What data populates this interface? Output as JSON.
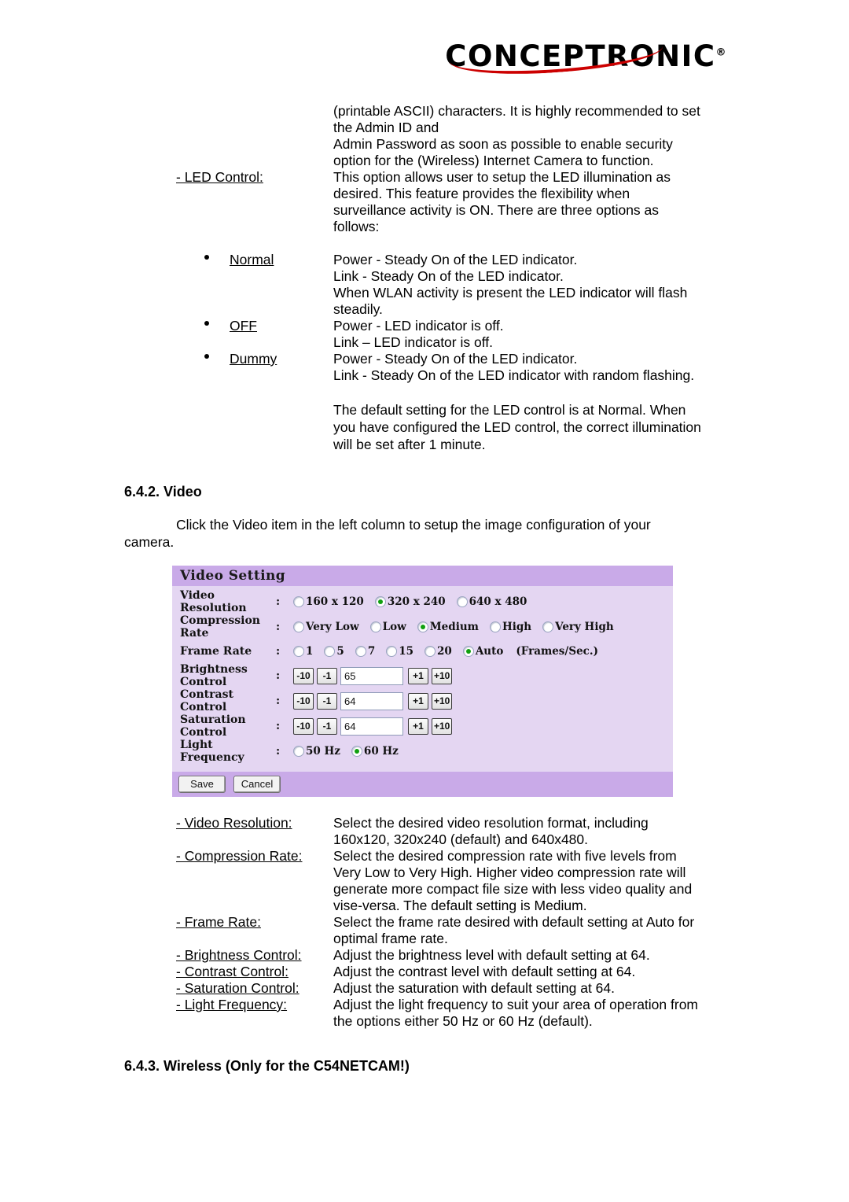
{
  "brand": {
    "name": "CONCEPTRONIC",
    "registered": "®"
  },
  "intro": {
    "lines": [
      "(printable ASCII) characters. It is highly recommended to set",
      "the Admin ID and",
      "Admin Password as soon as possible to enable security",
      "option for the (Wireless) Internet Camera to function."
    ]
  },
  "led_control": {
    "label": "- LED Control:",
    "lines": [
      "This option allows user to setup the LED illumination as",
      "desired.  This feature provides the flexibility when",
      "surveillance activity is ON. There are three options as",
      "follows:"
    ]
  },
  "led_options": [
    {
      "name": "Normal",
      "lines": [
        "Power - Steady On of the LED indicator.",
        "Link - Steady On of the LED indicator.",
        "When WLAN activity is present the LED indicator will flash",
        "steadily."
      ]
    },
    {
      "name": "OFF",
      "lines": [
        "Power - LED indicator is off.",
        "Link – LED indicator is off."
      ]
    },
    {
      "name": "Dummy",
      "lines": [
        "Power - Steady On of the LED indicator.",
        "Link - Steady On of the LED indicator with random flashing."
      ]
    }
  ],
  "led_default_note": {
    "lines": [
      "The default setting for the LED control is at  Normal.  When",
      "you have configured the LED control, the correct illumination",
      "will be set after 1 minute."
    ]
  },
  "section_video": {
    "heading": "6.4.2. Video",
    "intro_lines": [
      "Click the  Video item in the left column to setup the image configuration of your",
      "camera."
    ]
  },
  "video_setting_panel": {
    "title": "Video Setting",
    "colon": ":",
    "rows": {
      "video_resolution": {
        "label": "Video Resolution",
        "options": [
          {
            "text": "160 x 120",
            "selected": false
          },
          {
            "text": "320 x 240",
            "selected": true
          },
          {
            "text": "640 x 480",
            "selected": false
          }
        ]
      },
      "compression_rate": {
        "label": "Compression Rate",
        "options": [
          {
            "text": "Very Low",
            "selected": false
          },
          {
            "text": "Low",
            "selected": false
          },
          {
            "text": "Medium",
            "selected": true
          },
          {
            "text": "High",
            "selected": false
          },
          {
            "text": "Very High",
            "selected": false
          }
        ]
      },
      "frame_rate": {
        "label": "Frame Rate",
        "units": "(Frames/Sec.)",
        "options": [
          {
            "text": "1",
            "selected": false
          },
          {
            "text": "5",
            "selected": false
          },
          {
            "text": "7",
            "selected": false
          },
          {
            "text": "15",
            "selected": false
          },
          {
            "text": "20",
            "selected": false
          },
          {
            "text": "Auto",
            "selected": true
          }
        ]
      },
      "brightness_control": {
        "label": "Brightness Control",
        "minus10": "-10",
        "minus1": "-1",
        "value": "65",
        "plus1": "+1",
        "plus10": "+10"
      },
      "contrast_control": {
        "label": "Contrast Control",
        "minus10": "-10",
        "minus1": "-1",
        "value": "64",
        "plus1": "+1",
        "plus10": "+10"
      },
      "saturation_control": {
        "label": "Saturation Control",
        "minus10": "-10",
        "minus1": "-1",
        "value": "64",
        "plus1": "+1",
        "plus10": "+10"
      },
      "light_frequency": {
        "label": "Light Frequency",
        "options": [
          {
            "text": "50 Hz",
            "selected": false
          },
          {
            "text": "60 Hz",
            "selected": true
          }
        ]
      }
    },
    "save_label": "Save",
    "cancel_label": "Cancel"
  },
  "video_descriptions": [
    {
      "label": "- Video Resolution:",
      "lines": [
        "Select the desired video resolution format, including",
        "160x120,  320x240  (default) and 640x480."
      ]
    },
    {
      "label": "- Compression Rate:",
      "lines": [
        "Select the desired compression rate with five levels from",
        "Very Low to Very High. Higher video compression rate will",
        "generate more compact file size with less video quality and",
        "vise-versa.  The default setting is Medium."
      ]
    },
    {
      "label": "- Frame Rate:",
      "lines": [
        "Select the frame rate desired with default setting at Auto for",
        "optimal frame rate."
      ]
    },
    {
      "label": "- Brightness Control:",
      "lines": [
        "Adjust the brightness level with default setting at 64."
      ]
    },
    {
      "label": "- Contrast Control:",
      "lines": [
        "Adjust the contrast level with default setting at 64."
      ]
    },
    {
      "label": "- Saturation Control:",
      "lines": [
        "Adjust the saturation with default setting at 64."
      ]
    },
    {
      "label": "- Light Frequency:",
      "lines": [
        "Adjust the light frequency to suit your area of operation from",
        "the options either 50 Hz or 60 Hz (default)."
      ]
    }
  ],
  "section_wireless": {
    "heading": "6.4.3. Wireless  (Only for the C54NETCAM!)"
  },
  "colors": {
    "panel_header": "#c9aae8",
    "panel_body": "#e4d6f2",
    "radio_selected": "#10a010",
    "brand_accent": "#cc0000"
  }
}
